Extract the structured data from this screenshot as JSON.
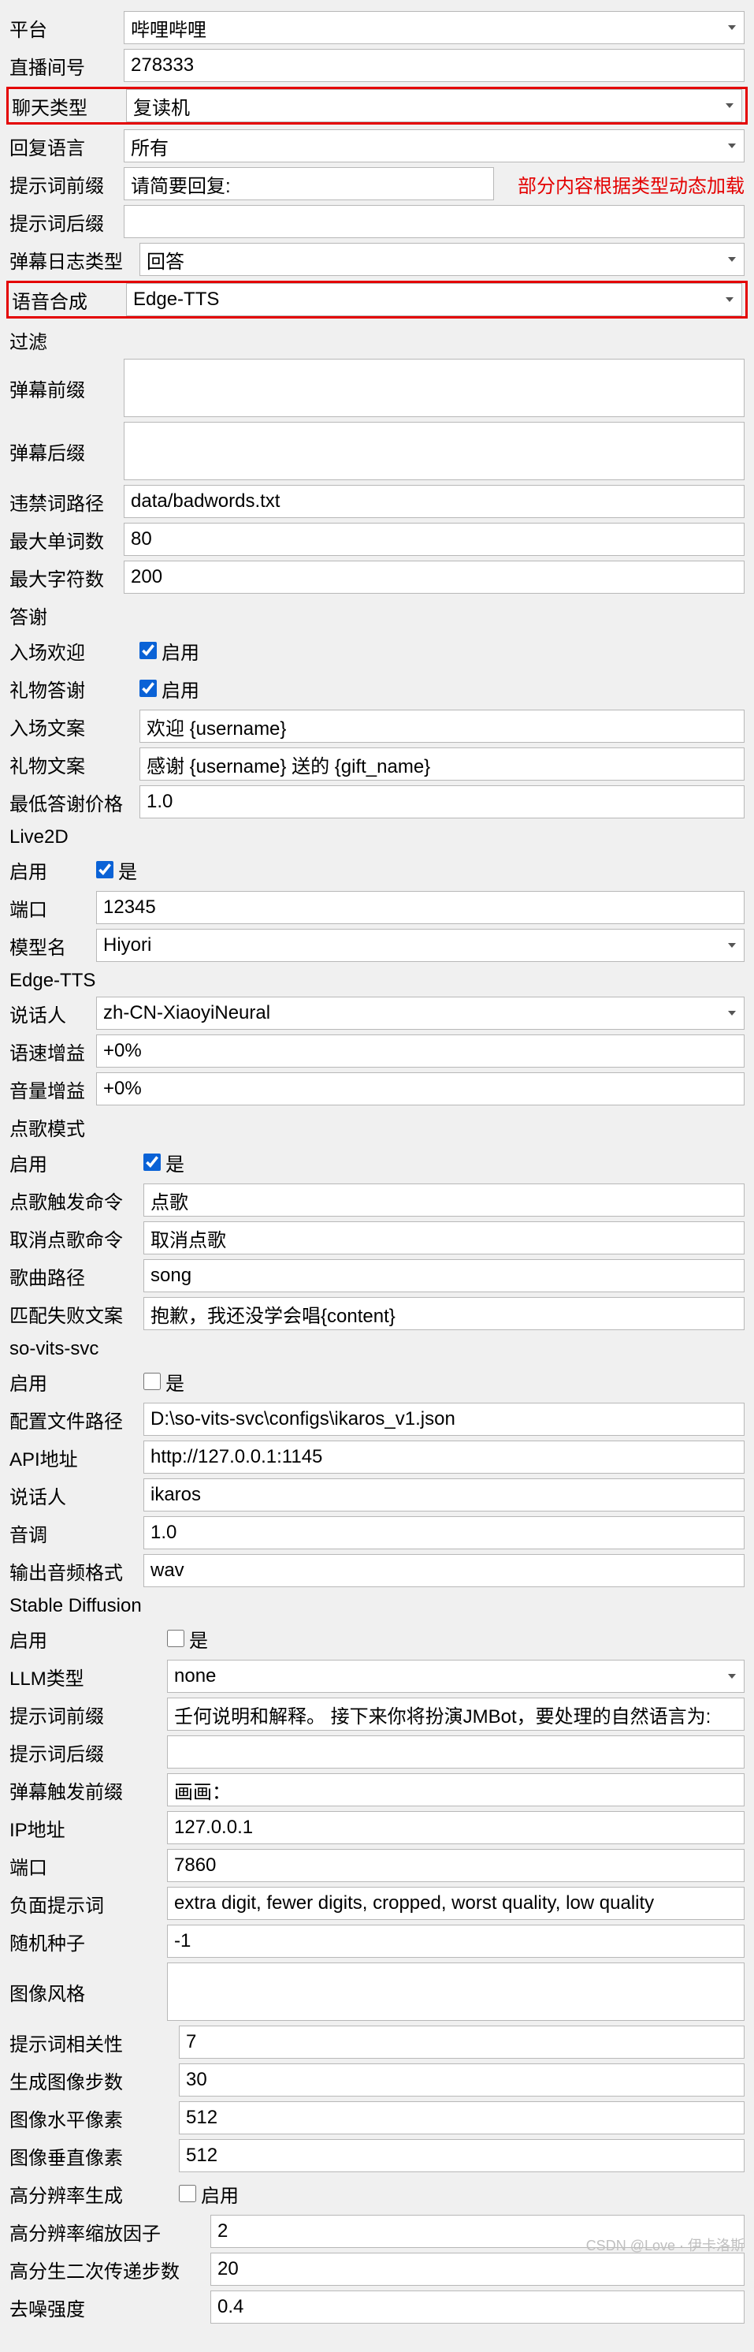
{
  "basic": {
    "platform_label": "平台",
    "platform_value": "哔哩哔哩",
    "room_label": "直播间号",
    "room_value": "278333",
    "chat_type_label": "聊天类型",
    "chat_type_value": "复读机",
    "reply_lang_label": "回复语言",
    "reply_lang_value": "所有",
    "prompt_prefix_label": "提示词前缀",
    "prompt_prefix_value": "请简要回复:",
    "dynamic_note": "部分内容根据类型动态加载",
    "prompt_suffix_label": "提示词后缀",
    "prompt_suffix_value": "",
    "danmu_log_label": "弹幕日志类型",
    "danmu_log_value": "回答",
    "tts_label": "语音合成",
    "tts_value": "Edge-TTS"
  },
  "filter": {
    "title": "过滤",
    "danmu_prefix_label": "弹幕前缀",
    "danmu_prefix_value": "",
    "danmu_suffix_label": "弹幕后缀",
    "danmu_suffix_value": "",
    "badwords_label": "违禁词路径",
    "badwords_value": "data/badwords.txt",
    "max_words_label": "最大单词数",
    "max_words_value": "80",
    "max_chars_label": "最大字符数",
    "max_chars_value": "200"
  },
  "thanks": {
    "title": "答谢",
    "enter_label": "入场欢迎",
    "enter_chk": "启用",
    "gift_label": "礼物答谢",
    "gift_chk": "启用",
    "enter_text_label": "入场文案",
    "enter_text_value": "欢迎 {username}",
    "gift_text_label": "礼物文案",
    "gift_text_value": "感谢 {username} 送的 {gift_name}",
    "min_price_label": "最低答谢价格",
    "min_price_value": "1.0"
  },
  "live2d": {
    "title": "Live2D",
    "enable_label": "启用",
    "enable_chk": "是",
    "port_label": "端口",
    "port_value": "12345",
    "model_label": "模型名",
    "model_value": "Hiyori"
  },
  "edge": {
    "title": "Edge-TTS",
    "speaker_label": "说话人",
    "speaker_value": "zh-CN-XiaoyiNeural",
    "rate_label": "语速增益",
    "rate_value": "+0%",
    "volume_label": "音量增益",
    "volume_value": "+0%"
  },
  "song": {
    "title": "点歌模式",
    "enable_label": "启用",
    "enable_chk": "是",
    "trigger_label": "点歌触发命令",
    "trigger_value": "点歌",
    "cancel_label": "取消点歌命令",
    "cancel_value": "取消点歌",
    "path_label": "歌曲路径",
    "path_value": "song",
    "fail_label": "匹配失败文案",
    "fail_value": "抱歉，我还没学会唱{content}"
  },
  "sovits": {
    "title": "so-vits-svc",
    "enable_label": "启用",
    "enable_chk": "是",
    "config_label": "配置文件路径",
    "config_value": "D:\\so-vits-svc\\configs\\ikaros_v1.json",
    "api_label": "API地址",
    "api_value": "http://127.0.0.1:1145",
    "speaker_label": "说话人",
    "speaker_value": "ikaros",
    "pitch_label": "音调",
    "pitch_value": "1.0",
    "format_label": "输出音频格式",
    "format_value": "wav"
  },
  "sd": {
    "title": "Stable Diffusion",
    "enable_label": "启用",
    "enable_chk": "是",
    "llm_label": "LLM类型",
    "llm_value": "none",
    "prefix_label": "提示词前缀",
    "prefix_value": "壬何说明和解释。 接下来你将扮演JMBot，要处理的自然语言为:",
    "suffix_label": "提示词后缀",
    "suffix_value": "",
    "trigger_label": "弹幕触发前缀",
    "trigger_value": "画画：",
    "ip_label": "IP地址",
    "ip_value": "127.0.0.1",
    "port_label": "端口",
    "port_value": "7860",
    "neg_label": "负面提示词",
    "neg_value": "extra digit, fewer digits, cropped, worst quality, low quality",
    "seed_label": "随机种子",
    "seed_value": "-1",
    "style_label": "图像风格",
    "style_value": "",
    "cfg_label": "提示词相关性",
    "cfg_value": "7",
    "steps_label": "生成图像步数",
    "steps_value": "30",
    "width_label": "图像水平像素",
    "width_value": "512",
    "height_label": "图像垂直像素",
    "height_value": "512",
    "hires_label": "高分辨率生成",
    "hires_chk": "启用",
    "hires_scale_label": "高分辨率缩放因子",
    "hires_scale_value": "2",
    "hires_steps_label": "高分生二次传递步数",
    "hires_steps_value": "20",
    "denoise_label": "去噪强度",
    "denoise_value": "0.4"
  },
  "watermark": "CSDN @Love · 伊卡洛斯"
}
